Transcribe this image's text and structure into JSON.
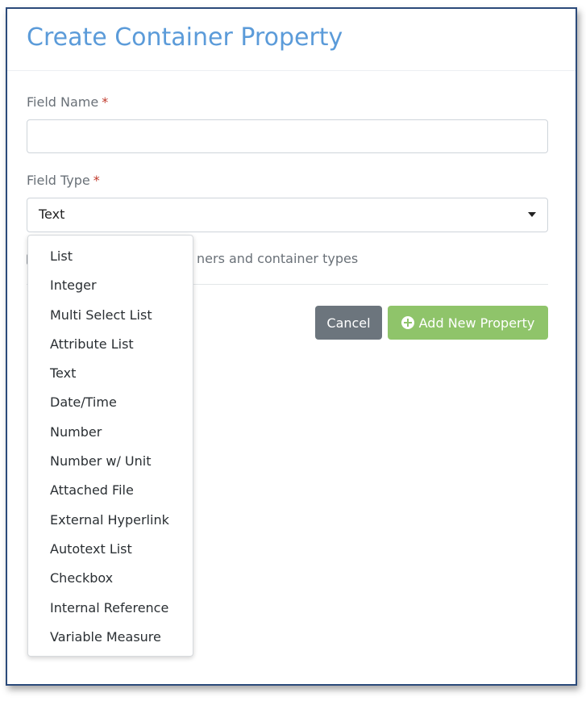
{
  "dialog": {
    "title": "Create Container Property"
  },
  "form": {
    "field_name_label": "Field Name",
    "field_type_label": "Field Type",
    "required_marker": "*",
    "field_name_value": "",
    "field_type_value": "Text",
    "help_text_visible": "ners and container types"
  },
  "buttons": {
    "cancel_label": "Cancel",
    "add_label": "Add New Property"
  },
  "dropdown": {
    "options": [
      "List",
      "Integer",
      "Multi Select List",
      "Attribute List",
      "Text",
      "Date/Time",
      "Number",
      "Number w/ Unit",
      "Attached File",
      "External Hyperlink",
      "Autotext List",
      "Checkbox",
      "Internal Reference",
      "Variable Measure"
    ]
  },
  "colors": {
    "title": "#5b9bd9",
    "required": "#c0392b",
    "cancel_button": "#6c757d",
    "add_button": "#8fc46a",
    "frame_border": "#2b4a7a"
  },
  "icons": {
    "add_button_icon": "plus-circle-icon",
    "select_caret": "caret-down-icon"
  }
}
